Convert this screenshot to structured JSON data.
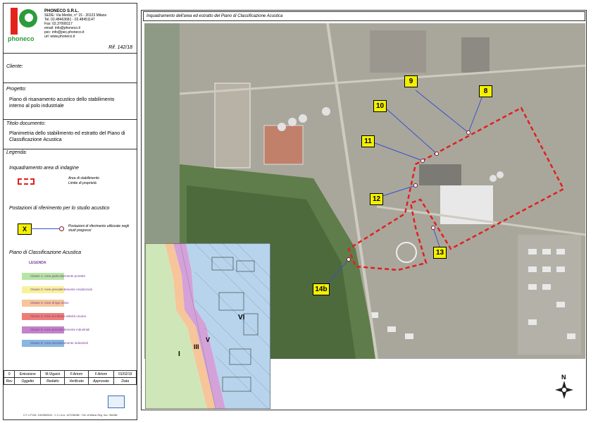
{
  "company": {
    "logo_letter": "P",
    "logo_text": "phoneco",
    "name": "PHONECO S.R.L.",
    "address": "SEDE: Via Medici, n° 15 - 20123 Milano",
    "tel": "Tel. 02.48463681 - 02.48451147",
    "fax": "Fax: 02.37008117",
    "email": "email: info@phoneco.it",
    "pec": "pec: info@pec.phoneco.it",
    "url": "url: www.phoneco.it",
    "ref": "Rif. 142/18"
  },
  "cliente_label": "Cliente:",
  "progetto_label": "Progetto:",
  "progetto_text": "Piano di risanamento acustico dello stabilimento interno al polo industriale",
  "titolo_label": "Titolo documento:",
  "titolo_text": "Planimetria dello stabilimento ed estratto del Piano di Classificazione Acustica",
  "legenda_label": "Legenda:",
  "inquadramento_label": "Inquadramento area di indagine",
  "area_text_1": "Area di stabilimento",
  "area_text_2": "Limite di proprietà",
  "postazioni_label": "Postazioni di riferimento per lo studio acustico",
  "postazioni_marker": "X",
  "postazioni_text": "Postazioni di riferimento utilizzate negli studi pregressi",
  "piano_label": "Piano di Classificazione Acustica",
  "legenda_title": "LEGENDA",
  "classes": [
    {
      "label": "Classe 1: Aree particolarmente protette",
      "color": "#b6e6a3"
    },
    {
      "label": "Classe 2: Aree prevalentemente residenziali",
      "color": "#f7f29a"
    },
    {
      "label": "Classe 3: Aree di tipo misto",
      "color": "#f6c69a"
    },
    {
      "label": "Classe 4: Aree di intensa attività umana",
      "color": "#ee7d77"
    },
    {
      "label": "Classe 5: Aree prevalentemente industriali",
      "color": "#c383c9"
    },
    {
      "label": "Classe 6: Aree esclusivamente industriali",
      "color": "#86b8e0"
    }
  ],
  "revision": {
    "row": [
      "0",
      "Emissione",
      "M.Viganò",
      "F.Artom",
      "F.Artom",
      "01/02/19"
    ],
    "headers": [
      "Rev",
      "Oggetto",
      "Redatto",
      "Verificato",
      "Approvato",
      "Data"
    ]
  },
  "footer_text": "C.F. e P.IVA: 11629830151 - C.C.I.A.A. 1472280/86 - Trib. di Milano Reg. Soc. 354286",
  "map_title": "Inquadramento dell'area ed estratto del Piano di Classificazione Acustica",
  "markers": [
    "8",
    "9",
    "10",
    "11",
    "12",
    "13",
    "14b"
  ],
  "zone_labels": [
    "I",
    "III",
    "V",
    "VI"
  ],
  "north_label": "N",
  "colors": {
    "boundary": "#e02020",
    "marker": "#f4f000",
    "line": "#3a4fd0"
  }
}
